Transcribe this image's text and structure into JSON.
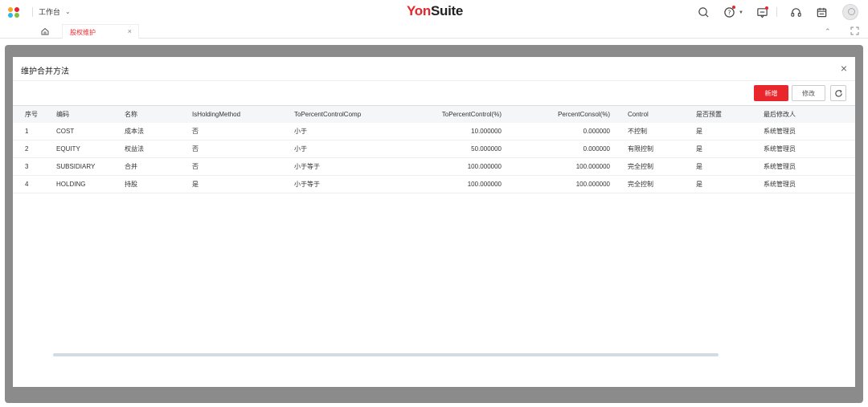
{
  "topbar": {
    "workbench_label": "工作台",
    "brand_yon": "Yon",
    "brand_suite": "Suite",
    "logo_colors": [
      "#f5a623",
      "#e8262c",
      "#2fb5e6",
      "#7ac143"
    ],
    "icons": [
      "app-logo-icon",
      "search-icon",
      "help-icon",
      "message-icon",
      "headset-icon",
      "calendar-icon",
      "avatar"
    ]
  },
  "tabs": [
    {
      "label": "股权维护",
      "close": "×"
    }
  ],
  "modal": {
    "title": "维护合并方法",
    "close": "×",
    "buttons": {
      "new": "新增",
      "edit": "修改"
    },
    "accent_color": "#e8262c"
  },
  "table": {
    "columns": [
      "序号",
      "编码",
      "名称",
      "IsHoldingMethod",
      "ToPercentControlComp",
      "ToPercentControl(%)",
      "PercentConsol(%)",
      "Control",
      "是否预置",
      "最后修改人"
    ],
    "rows": [
      [
        "1",
        "COST",
        "成本法",
        "否",
        "小于",
        "10.000000",
        "0.000000",
        "不控制",
        "是",
        "系统管理员"
      ],
      [
        "2",
        "EQUITY",
        "权益法",
        "否",
        "小于",
        "50.000000",
        "0.000000",
        "有限控制",
        "是",
        "系统管理员"
      ],
      [
        "3",
        "SUBSIDIARY",
        "合并",
        "否",
        "小于等于",
        "100.000000",
        "100.000000",
        "完全控制",
        "是",
        "系统管理员"
      ],
      [
        "4",
        "HOLDING",
        "持股",
        "是",
        "小于等于",
        "100.000000",
        "100.000000",
        "完全控制",
        "是",
        "系统管理员"
      ]
    ]
  }
}
